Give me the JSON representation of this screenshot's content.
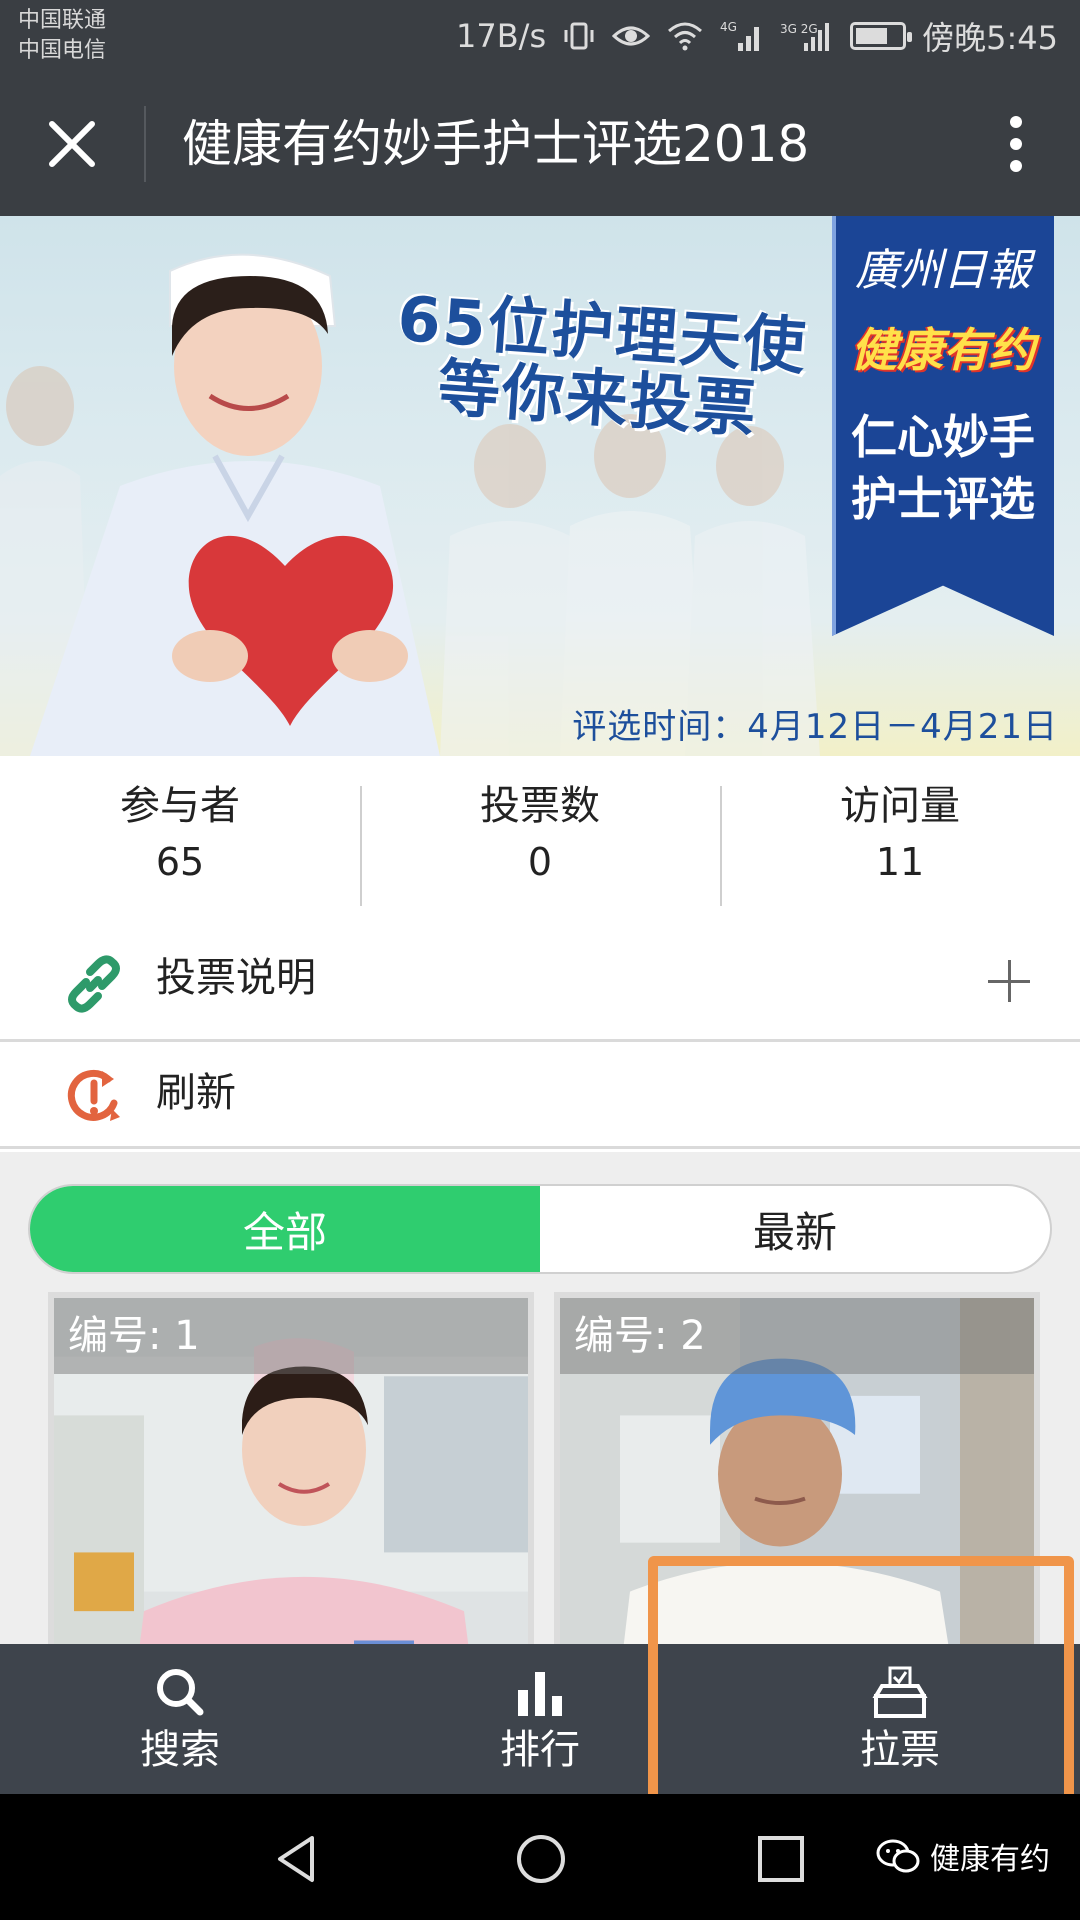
{
  "status_bar": {
    "carrier_1": "中国联通",
    "carrier_2": "中国电信",
    "speed": "17B/s",
    "signal_1": "4G",
    "signal_2": "3G 2G",
    "battery_level": 0.7,
    "time": "傍晚5:45"
  },
  "header": {
    "title": "健康有约妙手护士评选2018"
  },
  "banner": {
    "headline_line1": "65位护理天使",
    "headline_line2": "等你来投票",
    "ribbon_paper": "廣州日報",
    "ribbon_logo": "健康有约",
    "ribbon_slogan_line1": "仁心妙手",
    "ribbon_slogan_line2": "护士评选",
    "date_range": "评选时间：4月12日－4月21日"
  },
  "stats": [
    {
      "label": "参与者",
      "value": "65"
    },
    {
      "label": "投票数",
      "value": "0"
    },
    {
      "label": "访问量",
      "value": "11"
    }
  ],
  "rows": {
    "rules_label": "投票说明",
    "refresh_label": "刷新"
  },
  "tabs": {
    "all": "全部",
    "latest": "最新"
  },
  "cards": [
    {
      "id_text": "编号: 1"
    },
    {
      "id_text": "编号: 2"
    }
  ],
  "bottom_nav": {
    "search": "搜索",
    "ranking": "排行",
    "canvass": "拉票"
  },
  "colors": {
    "toolbar": "#3a3e43",
    "bottom_nav": "#3e444c",
    "active_tab": "#2fcd6f",
    "highlight": "#f0954a",
    "link_icon": "#2e9a6a",
    "refresh_icon": "#e2643f"
  },
  "watermark": "健康有约"
}
